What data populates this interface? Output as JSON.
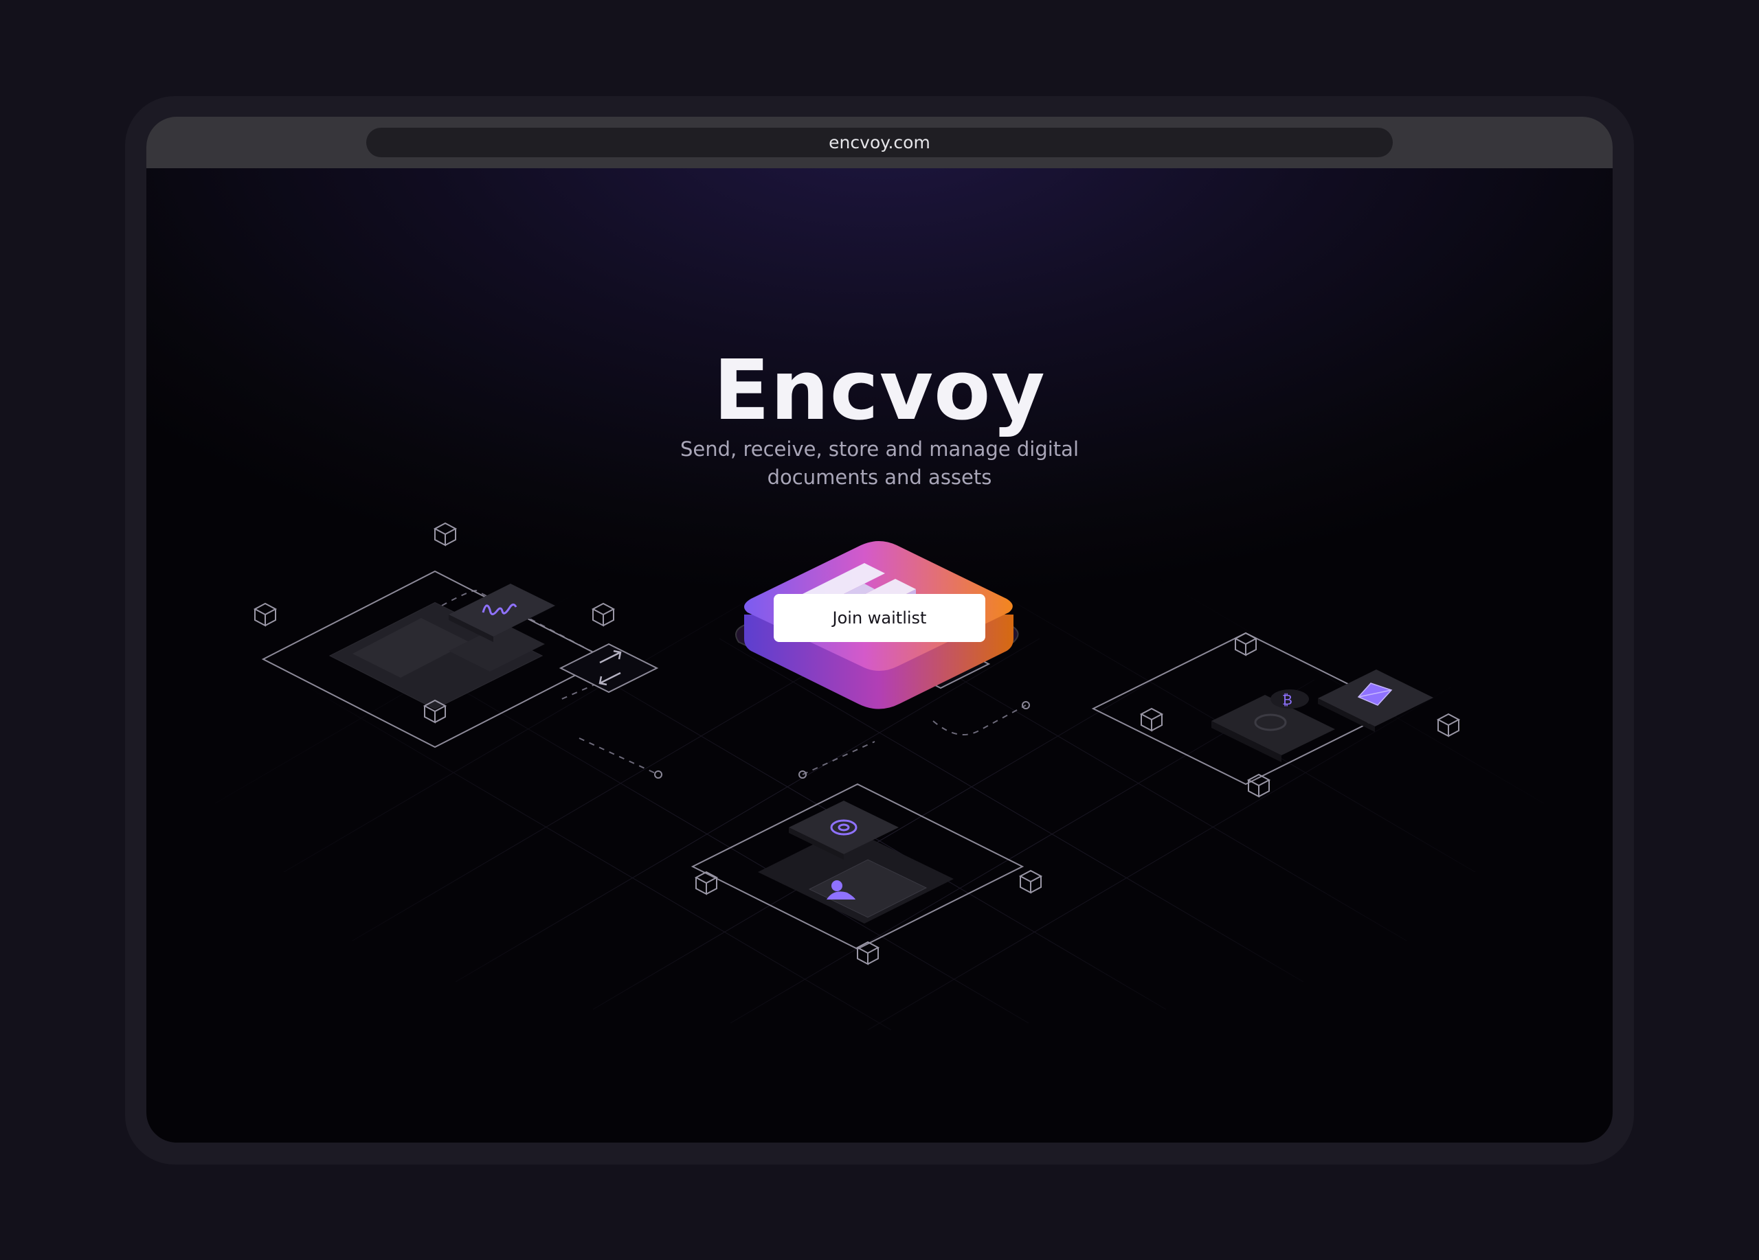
{
  "browser": {
    "url": "encvoy.com"
  },
  "hero": {
    "title": "Encvoy",
    "subtitle": "Send, receive, store and manage digital documents and assets",
    "cta_label": "Join waitlist"
  },
  "colors": {
    "background": "#13111b",
    "accent_purple": "#8b5cf6",
    "accent_orange": "#f08a2a",
    "button_bg": "#ffffff"
  },
  "icons": [
    "logo-icon",
    "signature-icon",
    "exchange-icon",
    "send-icon",
    "email-icon",
    "user-icon",
    "bitcoin-icon",
    "ethereum-icon",
    "node-cube-icon"
  ]
}
